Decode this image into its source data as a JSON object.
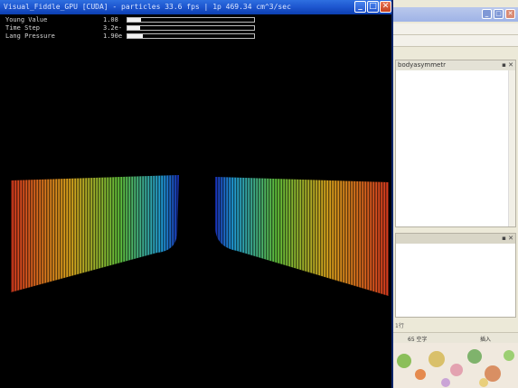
{
  "window": {
    "title": "Visual_Fiddle_GPU [CUDA] - particles 33.6 fps | 1p 469.34 cm^3/sec",
    "min_glyph": "_",
    "max_glyph": "□",
    "close_glyph": "✕"
  },
  "params": [
    {
      "label": "Young Value",
      "value": "1.08",
      "level": 0.11
    },
    {
      "label": "Time Step",
      "value": "3.2e-",
      "level": 0.1
    },
    {
      "label": "Lang Pressure",
      "value": "1.90e",
      "level": 0.12
    }
  ],
  "side": {
    "panel_tab": "bodyasymmetr",
    "panel_icons": "▪ ✕",
    "panel_b_icons": "▪ ✕",
    "status_left": "1行",
    "status_mid": "65 空字",
    "status_right": "插入"
  },
  "colors": {
    "titlebar": "#1d55cf",
    "canvas": "#000000",
    "spectrum": [
      "#d73a1e",
      "#d9a31c",
      "#5fbf3a",
      "#1f9ad6",
      "#1a2fb8"
    ]
  }
}
